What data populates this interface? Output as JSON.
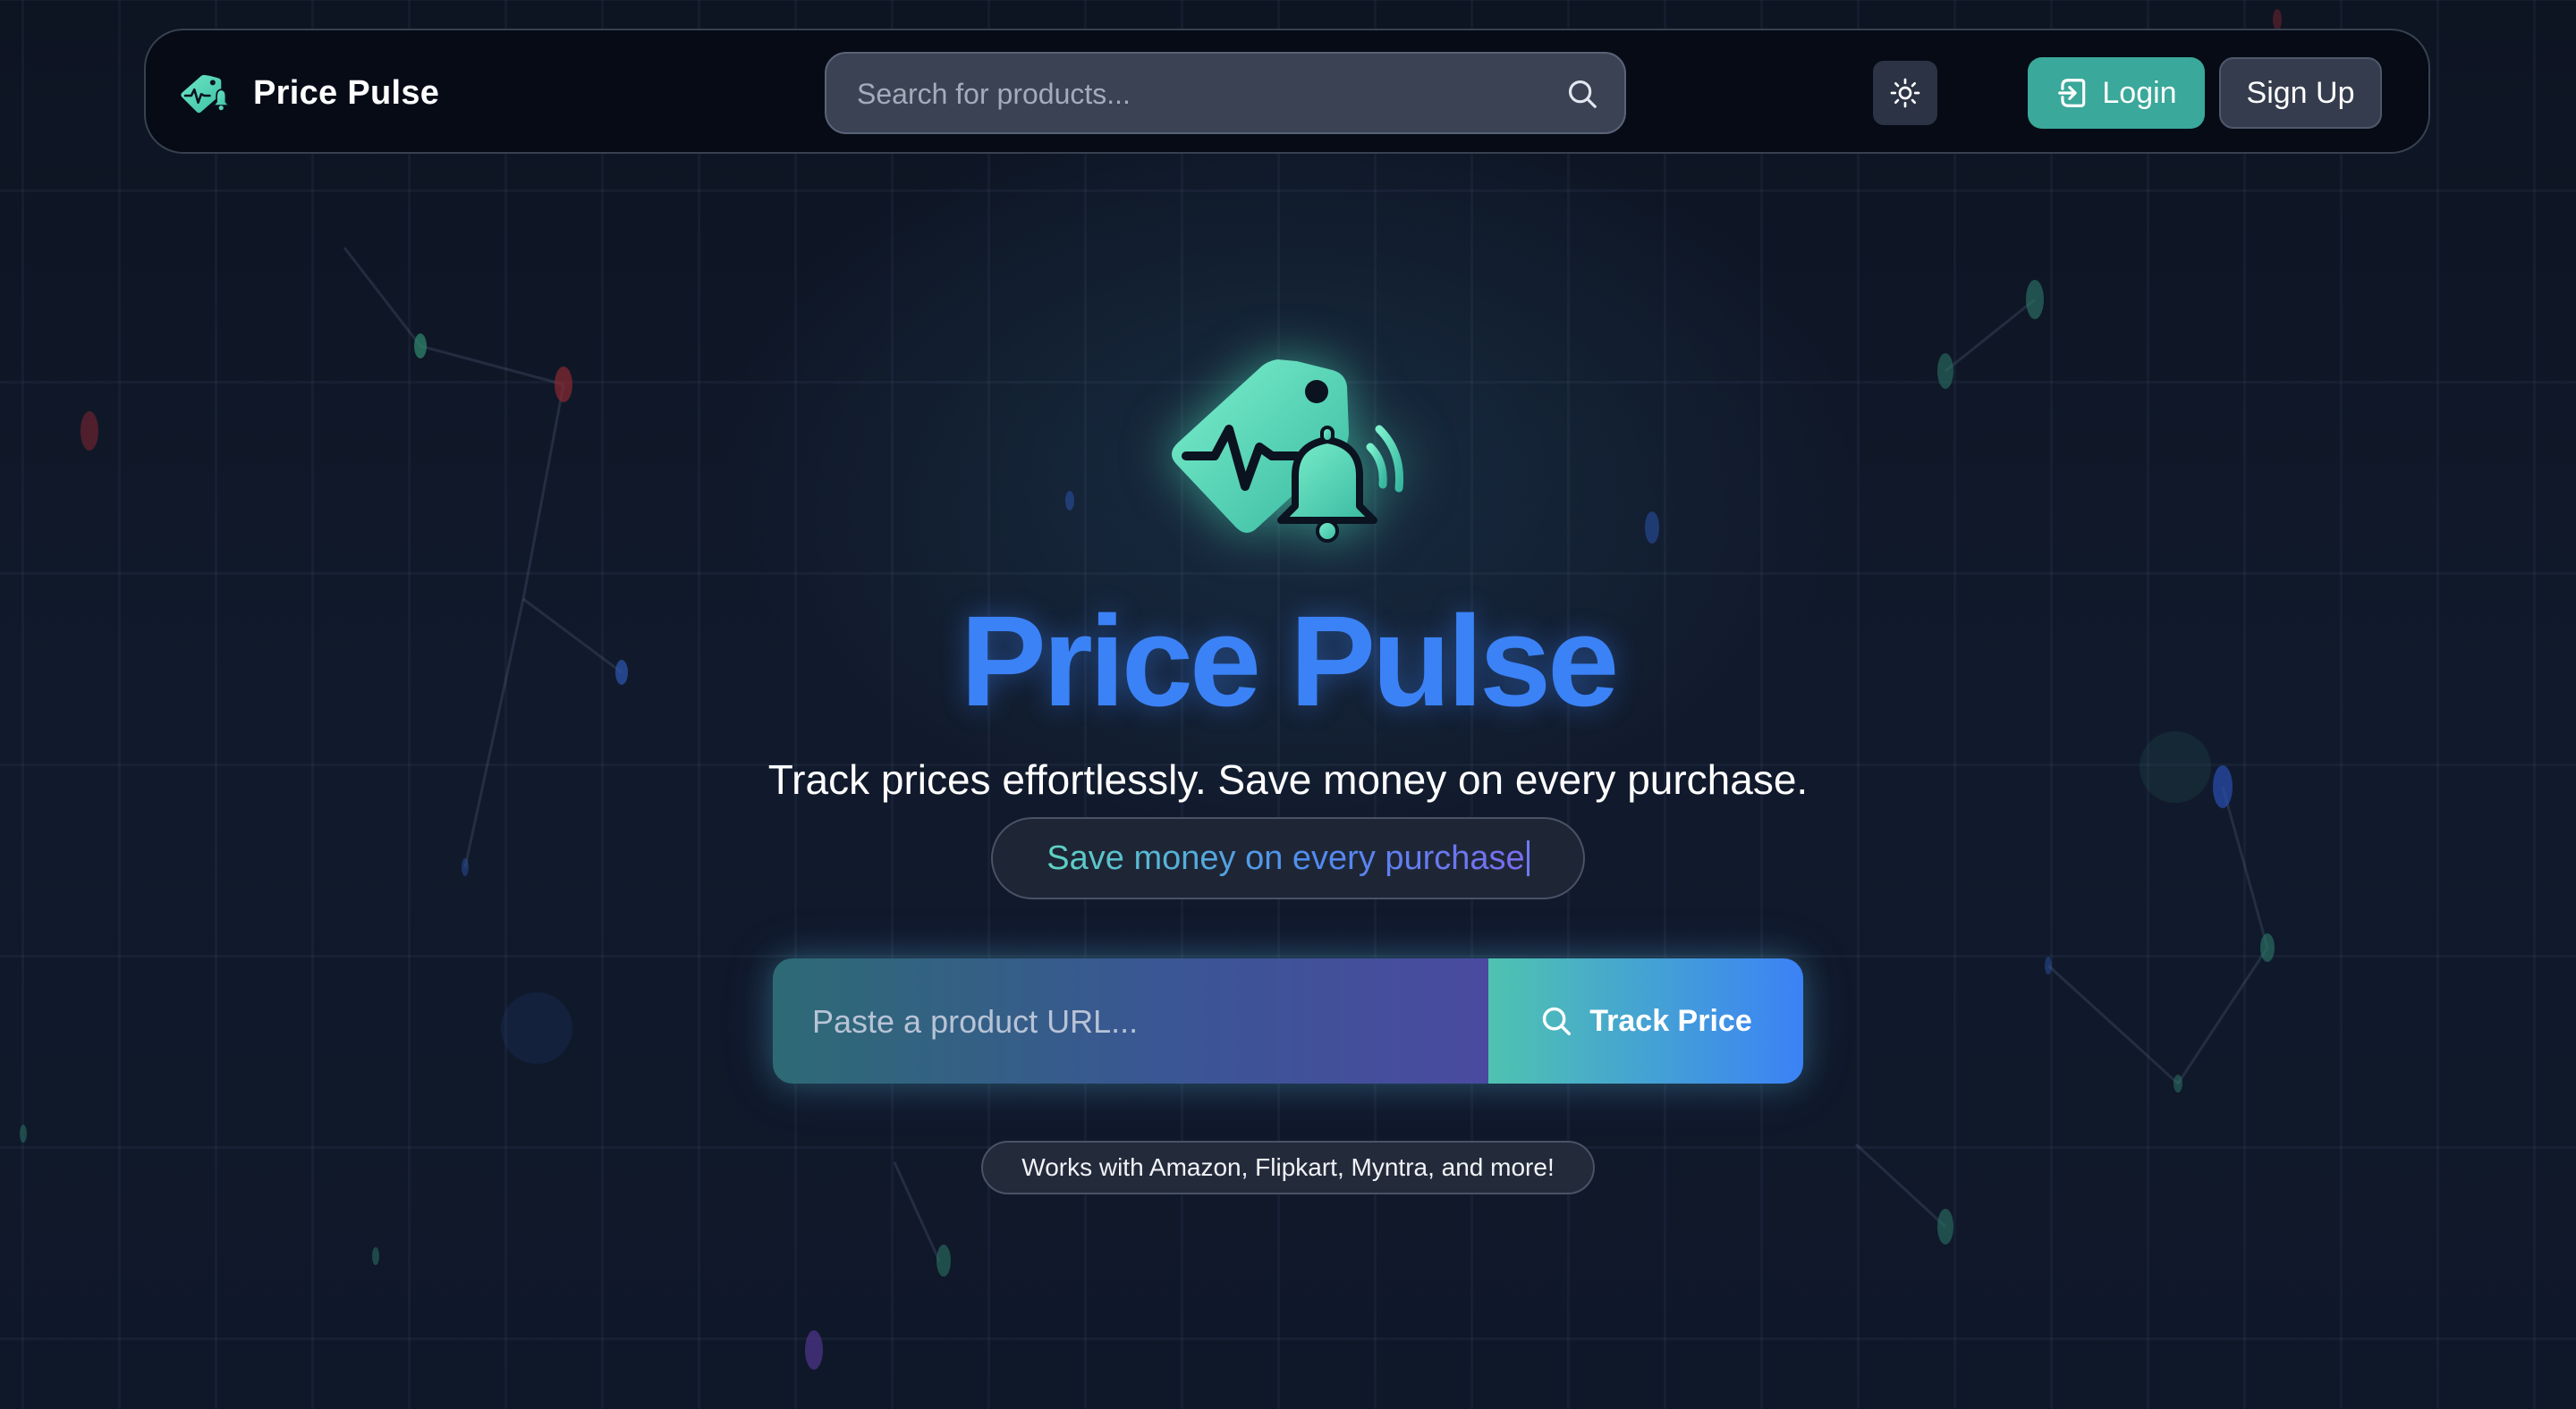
{
  "navbar": {
    "brand_name": "Price Pulse",
    "search_placeholder": "Search for products...",
    "login_label": "Login",
    "signup_label": "Sign Up"
  },
  "hero": {
    "title": "Price Pulse",
    "tagline": "Track prices effortlessly. Save money on every purchase.",
    "typing_text": "Save money on every purchase",
    "url_placeholder": "Paste a product URL...",
    "track_button_label": "Track Price",
    "supported_sites_note": "Works with Amazon, Flipkart, Myntra, and more!"
  },
  "icons": {
    "brand": "price-tag-bell-icon",
    "search": "search-icon",
    "theme": "sun-icon",
    "login": "login-icon"
  },
  "colors": {
    "accent_teal": "#3aa89a",
    "title_blue": "#3b82f6",
    "background": "#0f1626"
  }
}
